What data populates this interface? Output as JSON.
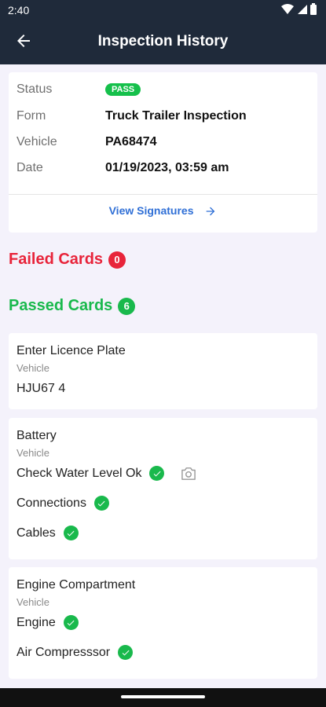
{
  "status_bar": {
    "time": "2:40",
    "icons": [
      "wifi-icon",
      "signal-icon",
      "battery-icon"
    ]
  },
  "header": {
    "title": "Inspection History"
  },
  "summary": {
    "status_label": "Status",
    "status_value": "PASS",
    "form_label": "Form",
    "form_value": "Truck Trailer Inspection",
    "vehicle_label": "Vehicle",
    "vehicle_value": "PA68474",
    "date_label": "Date",
    "date_value": "01/19/2023, 03:59 am",
    "view_signatures": "View Signatures"
  },
  "failed": {
    "label": "Failed Cards",
    "count": "0"
  },
  "passed": {
    "label": "Passed Cards",
    "count": "6"
  },
  "cards": [
    {
      "title": "Enter Licence Plate",
      "subtitle": "Vehicle",
      "value": "HJU67 4"
    },
    {
      "title": "Battery",
      "subtitle": "Vehicle",
      "items": [
        "Check Water Level Ok",
        "Connections",
        "Cables"
      ]
    },
    {
      "title": "Engine Compartment",
      "subtitle": "Vehicle",
      "items": [
        "Engine",
        "Air Compresssor"
      ]
    }
  ],
  "colors": {
    "header": "#1f2a3a",
    "pass": "#19b94c",
    "fail": "#e8243a",
    "link": "#2f6fd6"
  }
}
